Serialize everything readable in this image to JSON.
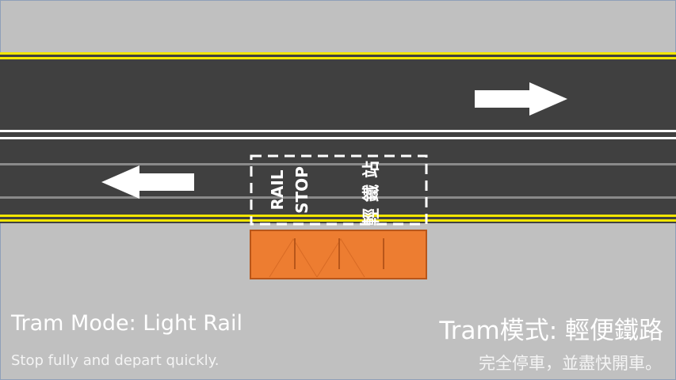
{
  "road_markings": {
    "stop_box_text_en": [
      "RAIL",
      "STOP"
    ],
    "stop_box_text_zh": "輕鐵站"
  },
  "captions": {
    "title_en": "Tram Mode: Light Rail",
    "subtitle_en": "Stop fully and depart quickly.",
    "title_zh": "Tram模式: 輕便鐵路",
    "subtitle_zh": "完全停車，並盡快開車。"
  },
  "colors": {
    "background": "#c0c0c0",
    "road": "#404040",
    "edge_line": "#f2e600",
    "lane_line": "#ffffff",
    "rail": "#8a8a8a",
    "platform": "#ed7d31",
    "platform_border": "#b8561a"
  }
}
